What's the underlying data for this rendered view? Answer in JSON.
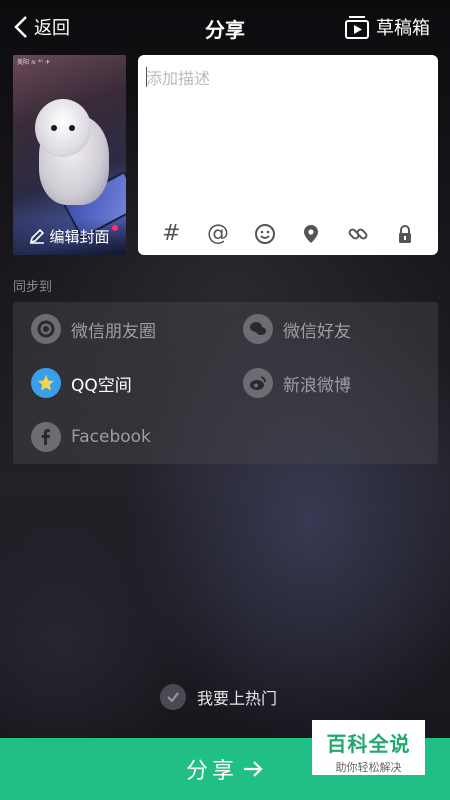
{
  "header": {
    "back_label": "返回",
    "title": "分享",
    "drafts_label": "草稿箱"
  },
  "cover": {
    "status_text": "美阳 ≋ ⁴ᴳ ✈",
    "edit_label": "编辑封面"
  },
  "description": {
    "placeholder": "添加描述",
    "value": "",
    "tools": [
      "hashtag-icon",
      "mention-icon",
      "emoji-icon",
      "location-icon",
      "link-icon",
      "lock-icon"
    ]
  },
  "sync": {
    "label": "同步到",
    "items": [
      {
        "label": "微信朋友圈",
        "icon": "wechat-moments-icon",
        "active": false
      },
      {
        "label": "微信好友",
        "icon": "wechat-icon",
        "active": false
      },
      {
        "label": "QQ空间",
        "icon": "qzone-icon",
        "active": true
      },
      {
        "label": "新浪微博",
        "icon": "weibo-icon",
        "active": false
      },
      {
        "label": "Facebook",
        "icon": "facebook-icon",
        "active": false
      }
    ]
  },
  "hot": {
    "label": "我要上热门",
    "checked": false
  },
  "share_button": {
    "label": "分享"
  },
  "watermark": {
    "title": "百科全说",
    "subtitle": "助你轻松解决"
  },
  "colors": {
    "accent": "#1fbf85",
    "qzone": "#3a9fe8",
    "notify_dot": "#ff2c6a"
  }
}
